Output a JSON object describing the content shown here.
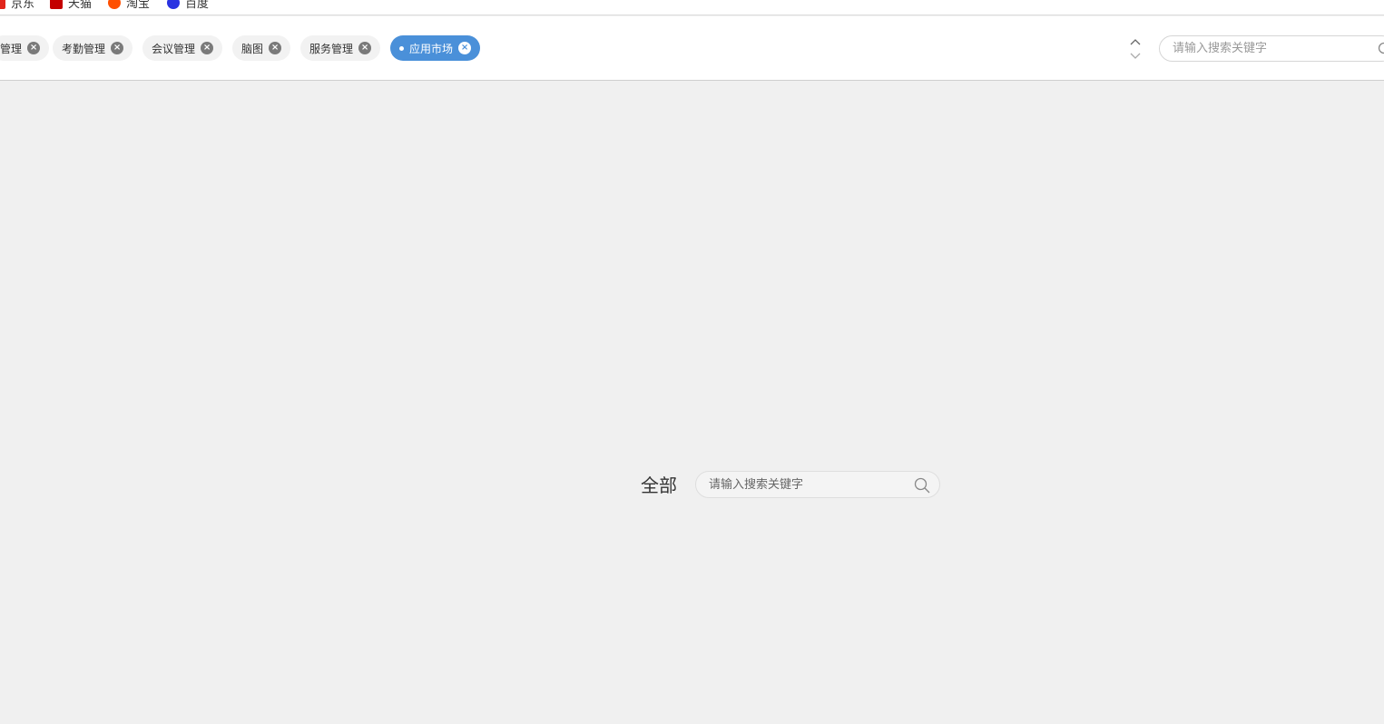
{
  "bookmarks": [
    {
      "label": "京东",
      "color": "#e1251b"
    },
    {
      "label": "天猫",
      "color": "#c40000"
    },
    {
      "label": "淘宝",
      "color": "#ff5000"
    },
    {
      "label": "百度",
      "color": "#2932e1"
    }
  ],
  "tabs": [
    {
      "label": "管理",
      "active": false
    },
    {
      "label": "考勤管理",
      "active": false
    },
    {
      "label": "会议管理",
      "active": false
    },
    {
      "label": "脑图",
      "active": false
    },
    {
      "label": "服务管理",
      "active": false
    },
    {
      "label": "应用市场",
      "active": true
    }
  ],
  "header_search": {
    "placeholder": "请输入搜索关键字"
  },
  "main": {
    "category_title": "全部",
    "search": {
      "placeholder": "请输入搜索关键字"
    }
  },
  "colors": {
    "active_tab": "#4a90d9",
    "background": "#f0f0f0"
  }
}
